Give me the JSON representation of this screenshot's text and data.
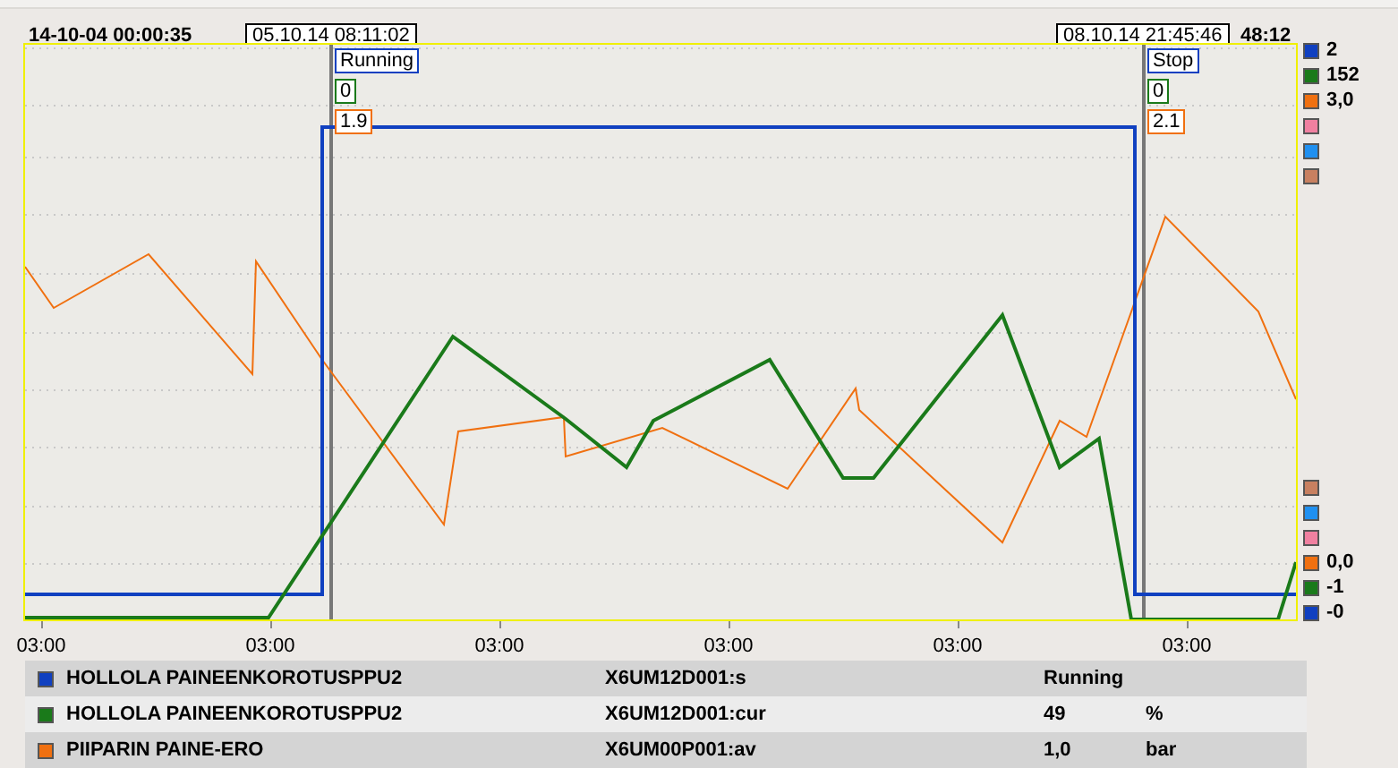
{
  "header": {
    "start_time": "14-10-04 00:00:35",
    "end_time": "48:12"
  },
  "cursors": [
    {
      "time": "05.10.14 08:11:02",
      "label": "Running",
      "readings": [
        {
          "text": "0",
          "color": "#1a7a1a"
        },
        {
          "text": "1.9",
          "color": "#f07010"
        }
      ]
    },
    {
      "time": "08.10.14 21:45:46",
      "label": "Stop",
      "readings": [
        {
          "text": "0",
          "color": "#1a7a1a"
        },
        {
          "text": "2.1",
          "color": "#f07010"
        }
      ]
    }
  ],
  "scale_top": [
    {
      "value": "2",
      "color": "#1040c0"
    },
    {
      "value": "152",
      "color": "#1a7a1a"
    },
    {
      "value": "3,0",
      "color": "#f07010"
    },
    {
      "color": "#f080a0"
    },
    {
      "color": "#2090f0"
    },
    {
      "color": "#c88060"
    }
  ],
  "scale_bottom": [
    {
      "color": "#c88060"
    },
    {
      "color": "#2090f0"
    },
    {
      "color": "#f080a0"
    },
    {
      "value": "0,0",
      "color": "#f07010"
    },
    {
      "value": "-1",
      "color": "#1a7a1a"
    },
    {
      "value": "-0",
      "color": "#1040c0"
    }
  ],
  "x_ticks": [
    "03:00",
    "03:00",
    "03:00",
    "03:00",
    "03:00",
    "03:00"
  ],
  "legend": [
    {
      "color": "#1040c0",
      "name": "HOLLOLA PAINEENKOROTUSPPU2",
      "tag": "X6UM12D001:s",
      "value": "Running"
    },
    {
      "color": "#1a7a1a",
      "name": "HOLLOLA PAINEENKOROTUSPPU2",
      "tag": "X6UM12D001:cur",
      "value": "49",
      "unit": "%"
    },
    {
      "color": "#f07010",
      "name": "PIIPARIN PAINE-ERO",
      "tag": "X6UM00P001:av",
      "value": "1,0",
      "unit": "bar"
    }
  ]
}
